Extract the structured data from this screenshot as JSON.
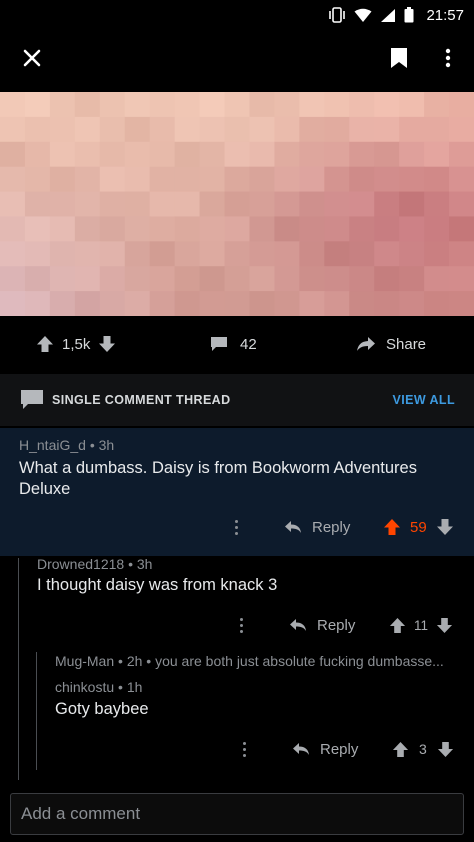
{
  "status_bar": {
    "time": "21:57"
  },
  "post": {
    "upvotes": "1,5k",
    "comment_count": "42",
    "share_label": "Share"
  },
  "thread": {
    "title": "SINGLE COMMENT THREAD",
    "view_all": "VIEW ALL"
  },
  "comments": [
    {
      "author": "H_ntaiG_d",
      "age": "3h",
      "body": "What a dumbass. Daisy is from Bookworm Adventures Deluxe",
      "reply_label": "Reply",
      "score": "59"
    },
    {
      "author": "Drowned1218",
      "age": "3h",
      "body": "I thought daisy was from knack 3",
      "reply_label": "Reply",
      "score": "11"
    },
    {
      "parent_author": "Mug-Man",
      "parent_age": "2h",
      "parent_snippet": "you are both just absolute fucking dumbasse...",
      "author": "chinkostu",
      "age": "1h",
      "body": "Goty baybee",
      "reply_label": "Reply",
      "score": "3"
    }
  ],
  "input": {
    "placeholder": "Add a comment"
  },
  "colors": {
    "upvote_active": "#ff4500",
    "link_blue": "#3d9ae0",
    "selected_comment_bg": "#0d1b2c"
  }
}
